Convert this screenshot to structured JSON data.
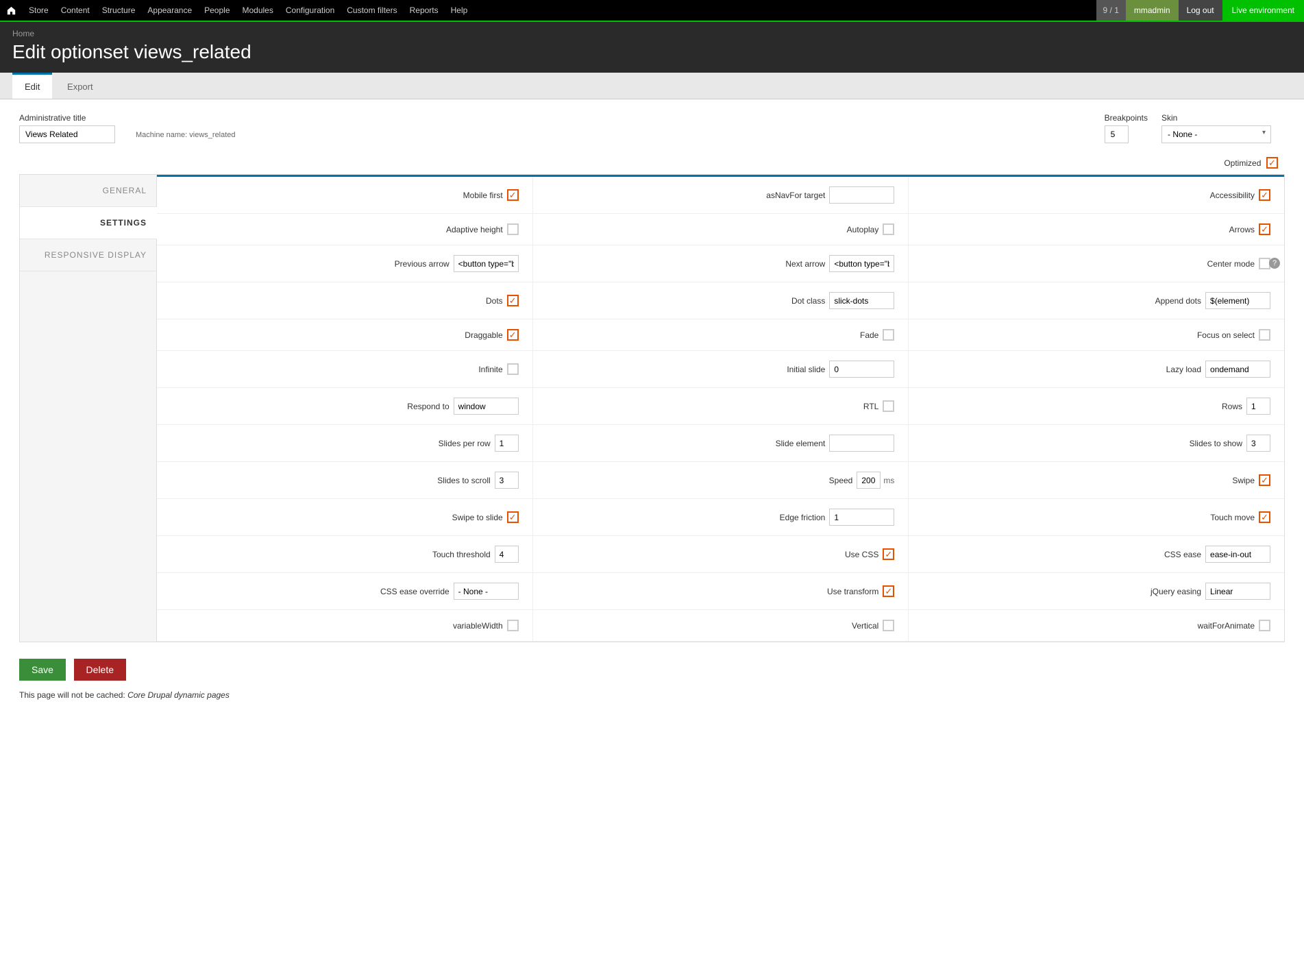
{
  "toolbar": {
    "items": [
      "Store",
      "Content",
      "Structure",
      "Appearance",
      "People",
      "Modules",
      "Configuration",
      "Custom filters",
      "Reports",
      "Help"
    ],
    "badge": "9 / 1",
    "user": "mmadmin",
    "logout": "Log out",
    "env": "Live environment"
  },
  "breadcrumb": {
    "home": "Home"
  },
  "page_title": "Edit optionset views_related",
  "tabs": {
    "edit": "Edit",
    "export": "Export"
  },
  "fields": {
    "admin_title_label": "Administrative title",
    "admin_title_value": "Views Related",
    "machine_name_label": "Machine name:",
    "machine_name_value": "views_related",
    "breakpoints_label": "Breakpoints",
    "breakpoints_value": "5",
    "skin_label": "Skin",
    "skin_value": "- None -",
    "optimized_label": "Optimized"
  },
  "vtabs": {
    "general": "GENERAL",
    "settings": "SETTINGS",
    "responsive": "RESPONSIVE DISPLAY"
  },
  "settings": {
    "row1": {
      "a": {
        "label": "Mobile first",
        "type": "check",
        "checked": true
      },
      "b": {
        "label": "asNavFor target",
        "type": "text",
        "value": ""
      },
      "c": {
        "label": "Accessibility",
        "type": "check",
        "checked": true
      }
    },
    "row2": {
      "a": {
        "label": "Adaptive height",
        "type": "check",
        "checked": false
      },
      "b": {
        "label": "Autoplay",
        "type": "check",
        "checked": false
      },
      "c": {
        "label": "Arrows",
        "type": "check",
        "checked": true
      }
    },
    "row3": {
      "a": {
        "label": "Previous arrow",
        "type": "text",
        "value": "<button type=\"button"
      },
      "b": {
        "label": "Next arrow",
        "type": "text",
        "value": "<button type=\"button"
      },
      "c": {
        "label": "Center mode",
        "type": "check",
        "checked": false
      }
    },
    "row4": {
      "a": {
        "label": "Dots",
        "type": "check",
        "checked": true
      },
      "b": {
        "label": "Dot class",
        "type": "text",
        "value": "slick-dots"
      },
      "c": {
        "label": "Append dots",
        "type": "text",
        "value": "$(element)"
      }
    },
    "row5": {
      "a": {
        "label": "Draggable",
        "type": "check",
        "checked": true
      },
      "b": {
        "label": "Fade",
        "type": "check",
        "checked": false
      },
      "c": {
        "label": "Focus on select",
        "type": "check",
        "checked": false
      }
    },
    "row6": {
      "a": {
        "label": "Infinite",
        "type": "check",
        "checked": false
      },
      "b": {
        "label": "Initial slide",
        "type": "text",
        "value": "0"
      },
      "c": {
        "label": "Lazy load",
        "type": "text",
        "value": "ondemand"
      }
    },
    "row7": {
      "a": {
        "label": "Respond to",
        "type": "text",
        "value": "window"
      },
      "b": {
        "label": "RTL",
        "type": "check",
        "checked": false
      },
      "c": {
        "label": "Rows",
        "type": "text",
        "value": "1",
        "narrow": true
      }
    },
    "row8": {
      "a": {
        "label": "Slides per row",
        "type": "text",
        "value": "1",
        "narrow": true
      },
      "b": {
        "label": "Slide element",
        "type": "text",
        "value": ""
      },
      "c": {
        "label": "Slides to show",
        "type": "text",
        "value": "3",
        "narrow": true
      }
    },
    "row9": {
      "a": {
        "label": "Slides to scroll",
        "type": "text",
        "value": "3",
        "narrow": true
      },
      "b": {
        "label": "Speed",
        "type": "text",
        "value": "200",
        "narrow": true,
        "suffix": "ms"
      },
      "c": {
        "label": "Swipe",
        "type": "check",
        "checked": true
      }
    },
    "row10": {
      "a": {
        "label": "Swipe to slide",
        "type": "check",
        "checked": true
      },
      "b": {
        "label": "Edge friction",
        "type": "text",
        "value": "1"
      },
      "c": {
        "label": "Touch move",
        "type": "check",
        "checked": true
      }
    },
    "row11": {
      "a": {
        "label": "Touch threshold",
        "type": "text",
        "value": "4",
        "narrow": true
      },
      "b": {
        "label": "Use CSS",
        "type": "check",
        "checked": true
      },
      "c": {
        "label": "CSS ease",
        "type": "text",
        "value": "ease-in-out"
      }
    },
    "row12": {
      "a": {
        "label": "CSS ease override",
        "type": "text",
        "value": "- None -"
      },
      "b": {
        "label": "Use transform",
        "type": "check",
        "checked": true
      },
      "c": {
        "label": "jQuery easing",
        "type": "text",
        "value": "Linear"
      }
    },
    "row13": {
      "a": {
        "label": "variableWidth",
        "type": "check",
        "checked": false
      },
      "b": {
        "label": "Vertical",
        "type": "check",
        "checked": false
      },
      "c": {
        "label": "waitForAnimate",
        "type": "check",
        "checked": false
      }
    }
  },
  "actions": {
    "save": "Save",
    "delete": "Delete"
  },
  "cache_note_prefix": "This page will not be cached: ",
  "cache_note_em": "Core Drupal dynamic pages"
}
